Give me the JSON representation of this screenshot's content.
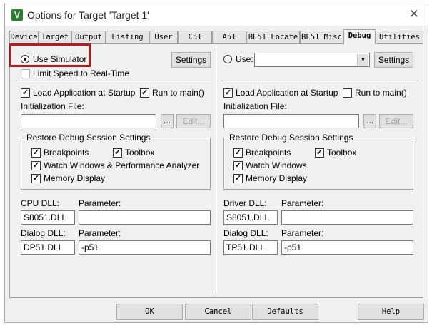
{
  "window": {
    "title": "Options for Target 'Target 1'",
    "icon_letter": "V",
    "close_glyph": "✕"
  },
  "tabs": [
    {
      "label": "Device",
      "active": false
    },
    {
      "label": "Target",
      "active": false
    },
    {
      "label": "Output",
      "active": false
    },
    {
      "label": "Listing",
      "active": false
    },
    {
      "label": "User",
      "active": false
    },
    {
      "label": "C51",
      "active": false
    },
    {
      "label": "A51",
      "active": false
    },
    {
      "label": "BL51 Locate",
      "active": false
    },
    {
      "label": "BL51 Misc",
      "active": false
    },
    {
      "label": "Debug",
      "active": true
    },
    {
      "label": "Utilities",
      "active": false
    }
  ],
  "left": {
    "use_simulator": "Use Simulator",
    "settings": "Settings",
    "limit_speed": "Limit Speed to Real-Time",
    "load_app": "Load Application at Startup",
    "run_to_main": "Run to main()",
    "init_file_label": "Initialization File:",
    "init_file_value": "",
    "browse": "...",
    "edit": "Edit...",
    "restore_group": "Restore Debug Session Settings",
    "breakpoints": "Breakpoints",
    "toolbox": "Toolbox",
    "watch": "Watch Windows & Performance Analyzer",
    "memory": "Memory Display",
    "dll_label": "CPU DLL:",
    "dll_param_label": "Parameter:",
    "dll_value": "S8051.DLL",
    "dll_param_value": "",
    "dialog_label": "Dialog DLL:",
    "dialog_param_label": "Parameter:",
    "dialog_value": "DP51.DLL",
    "dialog_param_value": "-p51"
  },
  "right": {
    "use": "Use:",
    "use_value": "",
    "settings": "Settings",
    "load_app": "Load Application at Startup",
    "run_to_main": "Run to main()",
    "init_file_label": "Initialization File:",
    "init_file_value": "",
    "browse": "...",
    "edit": "Edit...",
    "restore_group": "Restore Debug Session Settings",
    "breakpoints": "Breakpoints",
    "toolbox": "Toolbox",
    "watch": "Watch Windows",
    "memory": "Memory Display",
    "dll_label": "Driver DLL:",
    "dll_param_label": "Parameter:",
    "dll_value": "S8051.DLL",
    "dll_param_value": "",
    "dialog_label": "Dialog DLL:",
    "dialog_param_label": "Parameter:",
    "dialog_value": "TP51.DLL",
    "dialog_param_value": "-p51"
  },
  "checks": {
    "left_load_app": true,
    "left_run_to_main": true,
    "left_breakpoints": true,
    "left_toolbox": true,
    "left_watch": true,
    "left_memory": true,
    "right_load_app": true,
    "right_run_to_main": false,
    "right_breakpoints": true,
    "right_toolbox": true,
    "right_watch": true,
    "right_memory": true
  },
  "buttons": {
    "ok": "OK",
    "cancel": "Cancel",
    "defaults": "Defaults",
    "help": "Help"
  },
  "colors": {
    "highlight": "#b11c1c",
    "icon_bg": "#2e7d32"
  }
}
